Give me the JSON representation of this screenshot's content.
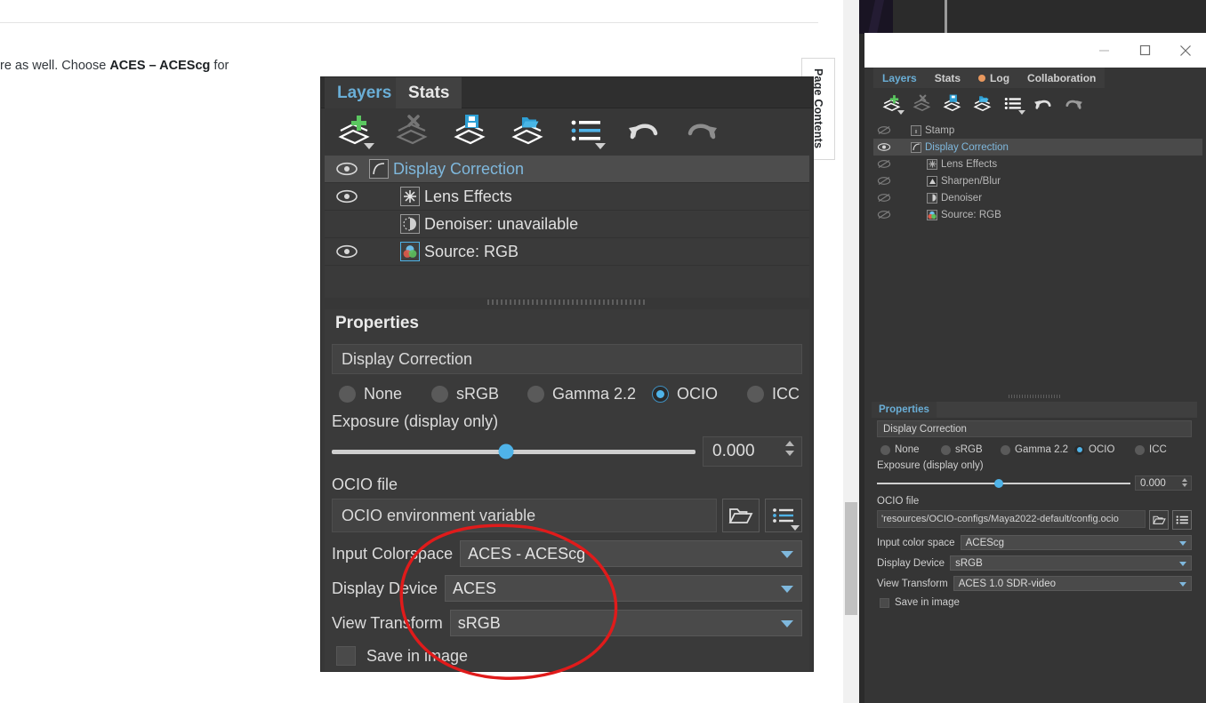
{
  "document": {
    "body_text_prefix": "re as well. Choose ",
    "body_text_bold": "ACES – ACEScg",
    "body_text_suffix": " for",
    "page_contents_tab": "Page Contents"
  },
  "zoom_panel": {
    "tabs": [
      {
        "label": "Layers",
        "active": true
      },
      {
        "label": "Stats",
        "active": false
      }
    ],
    "toolbar": [
      {
        "name": "add-layer-icon",
        "title": "Add layer"
      },
      {
        "name": "delete-layer-icon",
        "title": "Delete layer"
      },
      {
        "name": "save-layer-icon",
        "title": "Save layer"
      },
      {
        "name": "load-layer-icon",
        "title": "Load layer"
      },
      {
        "name": "layer-presets-icon",
        "title": "Layer presets"
      },
      {
        "name": "undo-icon",
        "title": "Undo"
      },
      {
        "name": "redo-icon",
        "title": "Redo"
      }
    ],
    "layers": [
      {
        "label": "Display Correction",
        "icon": "curve-icon",
        "visible": true,
        "selected": true,
        "indent": 0
      },
      {
        "label": "Lens Effects",
        "icon": "star-icon",
        "visible": true,
        "selected": false,
        "indent": 1
      },
      {
        "label": "Denoiser: unavailable",
        "icon": "denoiser-icon",
        "visible": false,
        "selected": false,
        "indent": 1
      },
      {
        "label": "Source: RGB",
        "icon": "rgb-icon",
        "visible": true,
        "selected": false,
        "indent": 1
      }
    ],
    "properties": {
      "header": "Properties",
      "name_value": "Display Correction",
      "modes": [
        {
          "label": "None",
          "selected": false
        },
        {
          "label": "sRGB",
          "selected": false
        },
        {
          "label": "Gamma 2.2",
          "selected": false
        },
        {
          "label": "OCIO",
          "selected": true
        },
        {
          "label": "ICC",
          "selected": false
        }
      ],
      "exposure_label": "Exposure (display only)",
      "exposure_value": "0.000",
      "exposure_percent": 48,
      "ocio_file_label": "OCIO file",
      "ocio_file_value": "OCIO environment variable",
      "ocio_browse_icon": "folder-open-icon",
      "ocio_presets_icon": "list-icon",
      "combos": [
        {
          "label": "Input Colorspace",
          "value": "ACES - ACEScg"
        },
        {
          "label": "Display Device",
          "value": "ACES"
        },
        {
          "label": "View Transform",
          "value": "sRGB"
        }
      ],
      "save_in_image_label": "Save in image",
      "save_in_image_checked": false
    },
    "annotation_color": "#e01b1b"
  },
  "app_window": {
    "window_controls": {
      "minimize": "–",
      "maximize": "□",
      "close": "✕"
    },
    "tabs": [
      {
        "label": "Layers",
        "active": true,
        "dot": false
      },
      {
        "label": "Stats",
        "active": false,
        "dot": false
      },
      {
        "label": "Log",
        "active": false,
        "dot": true
      },
      {
        "label": "Collaboration",
        "active": false,
        "dot": false
      }
    ],
    "toolbar": [
      {
        "name": "add-layer-icon",
        "title": "Add layer"
      },
      {
        "name": "delete-layer-icon",
        "title": "Delete layer"
      },
      {
        "name": "save-layer-icon",
        "title": "Save layer"
      },
      {
        "name": "load-layer-icon",
        "title": "Load layer"
      },
      {
        "name": "layer-presets-icon",
        "title": "Layer presets"
      },
      {
        "name": "undo-icon",
        "title": "Undo"
      },
      {
        "name": "redo-icon",
        "title": "Redo"
      }
    ],
    "layers": [
      {
        "label": "Stamp",
        "icon": "info-icon",
        "visible": false,
        "selected": false,
        "indent": 0
      },
      {
        "label": "Display Correction",
        "icon": "curve-icon",
        "visible": true,
        "selected": true,
        "indent": 0
      },
      {
        "label": "Lens Effects",
        "icon": "star-icon",
        "visible": false,
        "selected": false,
        "indent": 1
      },
      {
        "label": "Sharpen/Blur",
        "icon": "sharpen-icon",
        "visible": false,
        "selected": false,
        "indent": 1
      },
      {
        "label": "Denoiser",
        "icon": "denoiser-icon",
        "visible": false,
        "selected": false,
        "indent": 1
      },
      {
        "label": "Source: RGB",
        "icon": "rgb-icon",
        "visible": false,
        "selected": false,
        "indent": 1
      }
    ],
    "properties": {
      "header": "Properties",
      "name_value": "Display Correction",
      "modes": [
        {
          "label": "None",
          "selected": false
        },
        {
          "label": "sRGB",
          "selected": false
        },
        {
          "label": "Gamma 2.2",
          "selected": false
        },
        {
          "label": "OCIO",
          "selected": true
        },
        {
          "label": "ICC",
          "selected": false
        }
      ],
      "exposure_label": "Exposure (display only)",
      "exposure_value": "0.000",
      "exposure_percent": 48,
      "ocio_file_label": "OCIO file",
      "ocio_file_value": "'resources/OCIO-configs/Maya2022-default/config.ocio",
      "ocio_browse_icon": "folder-open-icon",
      "ocio_presets_icon": "list-icon",
      "combos": [
        {
          "label": "Input color space",
          "value": "ACEScg"
        },
        {
          "label": "Display Device",
          "value": "sRGB"
        },
        {
          "label": "View Transform",
          "value": "ACES 1.0 SDR-video"
        }
      ],
      "save_in_image_label": "Save in image",
      "save_in_image_checked": false
    }
  }
}
